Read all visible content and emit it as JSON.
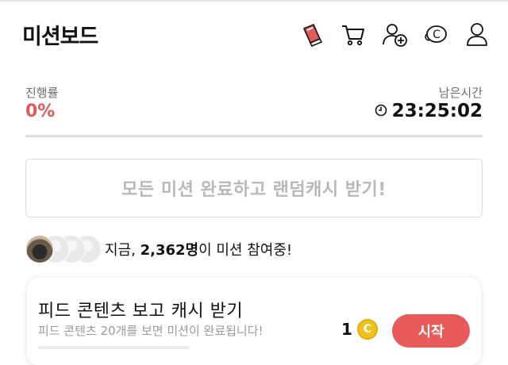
{
  "header": {
    "title": "미션보드",
    "icons": [
      "mission-icon",
      "cart-icon",
      "add-friend-icon",
      "cash-coin-icon",
      "profile-icon"
    ]
  },
  "progress": {
    "label": "진행률",
    "value_text": "0%",
    "fraction": 0,
    "accent": "#e05a5a"
  },
  "remaining": {
    "label": "남은시간",
    "time": "23:25:02"
  },
  "reward_banner": {
    "text": "모든 미션 완료하고 랜덤캐시 받기!"
  },
  "participants": {
    "prefix": "지금, ",
    "count": "2,362명",
    "suffix": "이 미션 참여중!"
  },
  "mission": {
    "title": "피드 콘텐츠 보고 캐시 받기",
    "description": "피드 콘텐츠 20개를 보면 미션이 완료됩니다!",
    "reward_count": "1",
    "coin_symbol": "C",
    "button_label": "시작",
    "button_color": "#ea5a5a"
  }
}
